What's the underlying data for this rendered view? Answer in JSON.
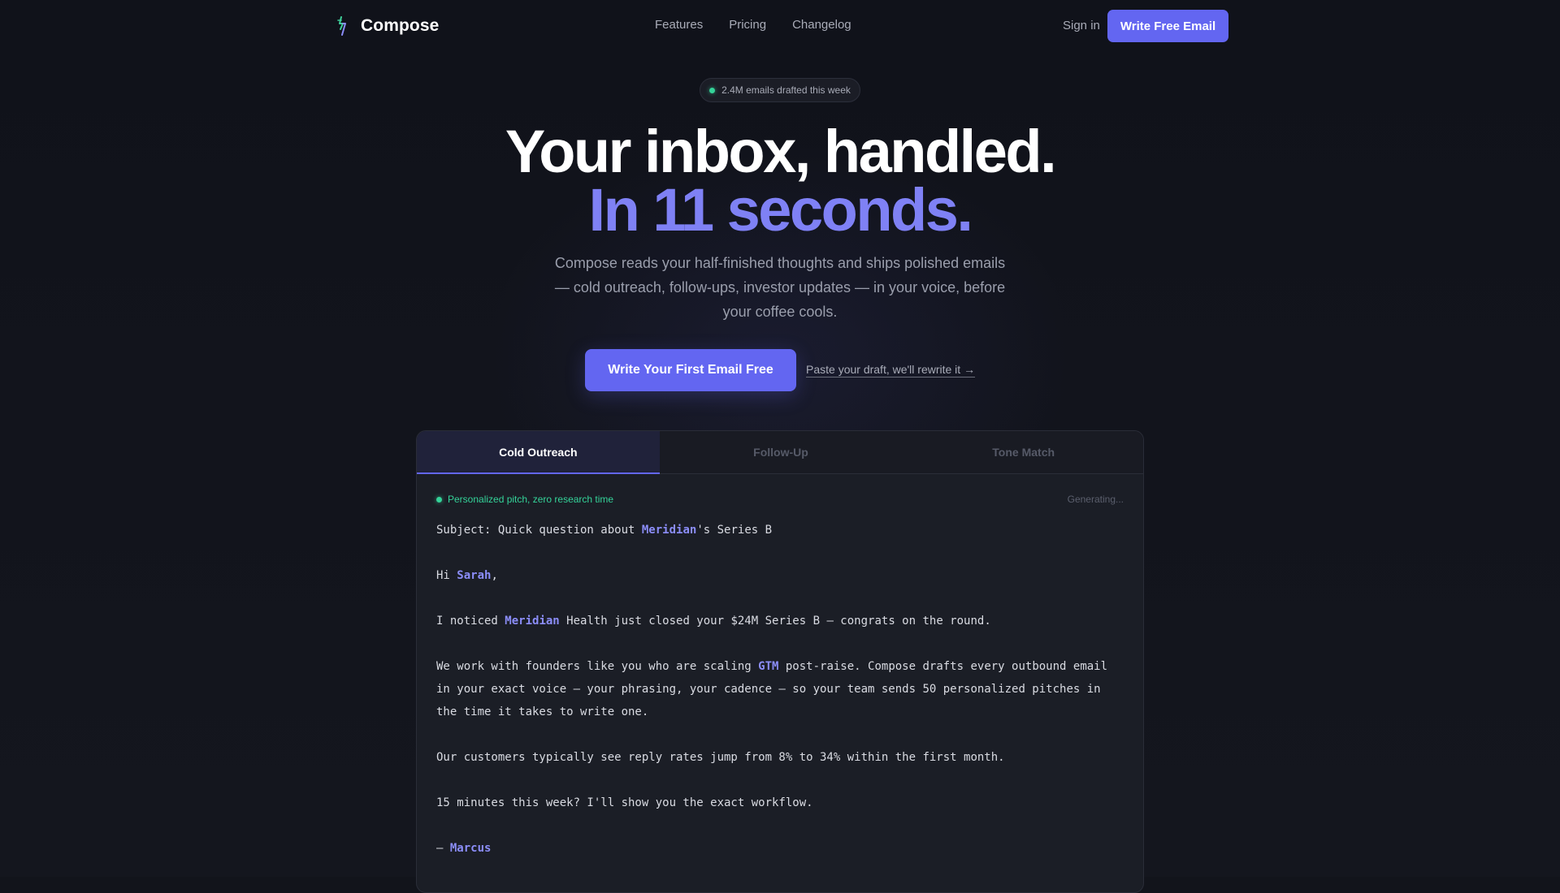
{
  "nav": {
    "brand": "Compose",
    "links": [
      "Features",
      "Pricing",
      "Changelog"
    ],
    "signin": "Sign in",
    "cta": "Write Free Email"
  },
  "badge": {
    "text": "2.4M emails drafted this week"
  },
  "hero": {
    "title_line1": "Your inbox, handled.",
    "title_line2": "In 11 seconds.",
    "subtitle": "Compose reads your half-finished thoughts and ships polished emails — cold outreach, follow-ups, investor updates — in your voice, before your coffee cools.",
    "cta_primary": "Write Your First Email Free",
    "cta_secondary": "Paste your draft, we'll rewrite it →"
  },
  "demo": {
    "tabs": [
      "Cold Outreach",
      "Follow-Up",
      "Tone Match"
    ],
    "active_tab": "Cold Outreach",
    "status_left": "Personalized pitch, zero research time",
    "status_right": "Generating...",
    "email": {
      "subject_prefix": "Subject: Quick question about ",
      "subject_company": "Meridian",
      "subject_suffix": "'s Series B",
      "greeting_prefix": "Hi ",
      "greeting_name": "Sarah",
      "greeting_suffix": ",",
      "p1_prefix": "I noticed ",
      "p1_company": "Meridian",
      "p1_suffix": " Health just closed your $24M Series B — congrats on the round.",
      "p2_prefix": "We work with founders like you who are scaling ",
      "p2_term": "GTM",
      "p2_suffix": " post-raise. Compose drafts every outbound email in your exact voice — your phrasing, your cadence — so your team sends 50 personalized pitches in the time it takes to write one.",
      "p3": "Our customers typically see reply rates jump from 8% to 34% within the first month.",
      "p4": "15 minutes this week? I'll show you the exact workflow.",
      "signoff_prefix": "— ",
      "signoff_name": "Marcus"
    }
  },
  "colors": {
    "accent": "#6366f1",
    "accent_text": "#7f81f5",
    "success": "#34d399",
    "background": "#12141b"
  }
}
